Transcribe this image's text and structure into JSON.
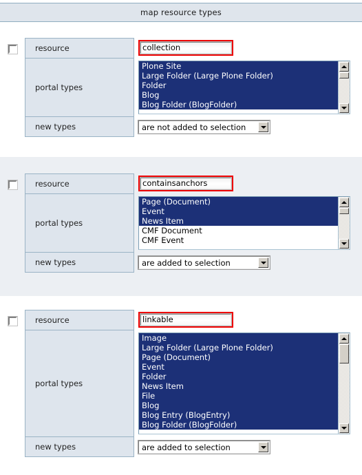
{
  "header": {
    "title": "map resource types"
  },
  "labels": {
    "resource": "resource",
    "portal_types": "portal types",
    "new_types": "new types"
  },
  "sections": [
    {
      "id": "collection",
      "checkbox_checked": false,
      "resource_value": "collection",
      "resource_highlighted": true,
      "portal_types_options": [
        {
          "label": "Plone Site",
          "selected": true
        },
        {
          "label": "Large Folder (Large Plone Folder)",
          "selected": true
        },
        {
          "label": "Folder",
          "selected": true
        },
        {
          "label": "Blog",
          "selected": true
        },
        {
          "label": "Blog Folder (BlogFolder)",
          "selected": true
        }
      ],
      "new_types_value": "are not added to selection",
      "visible_rows": 5
    },
    {
      "id": "containsanchors",
      "checkbox_checked": false,
      "resource_value": "containsanchors",
      "resource_highlighted": true,
      "portal_types_options": [
        {
          "label": "Page (Document)",
          "selected": true
        },
        {
          "label": "Event",
          "selected": true
        },
        {
          "label": "News Item",
          "selected": true
        },
        {
          "label": "CMF Document",
          "selected": false
        },
        {
          "label": "CMF Event",
          "selected": false
        }
      ],
      "new_types_value": "are added to selection",
      "visible_rows": 5
    },
    {
      "id": "linkable",
      "checkbox_checked": false,
      "resource_value": "linkable",
      "resource_highlighted": true,
      "portal_types_options": [
        {
          "label": "Image",
          "selected": true
        },
        {
          "label": "Large Folder (Large Plone Folder)",
          "selected": true
        },
        {
          "label": "Page (Document)",
          "selected": true
        },
        {
          "label": "Event",
          "selected": true
        },
        {
          "label": "Folder",
          "selected": true
        },
        {
          "label": "News Item",
          "selected": true
        },
        {
          "label": "File",
          "selected": true
        },
        {
          "label": "Blog",
          "selected": true
        },
        {
          "label": "Blog Entry (BlogEntry)",
          "selected": true
        },
        {
          "label": "Blog Folder (BlogFolder)",
          "selected": true
        }
      ],
      "new_types_value": "are added to selection",
      "visible_rows": 10
    }
  ],
  "colors": {
    "header_bg": "#dfe5ec",
    "header_border": "#8fadc0",
    "label_cell_bg": "#dee5ed",
    "cell_border": "#9ab3c5",
    "band_bg": "#eceff3",
    "selection_bg": "#1c3077",
    "highlight_border": "#ee0000"
  },
  "icons": {
    "scroll_up": "scroll-up-arrow-icon",
    "scroll_down": "scroll-down-arrow-icon",
    "dropdown": "chevron-down-icon"
  }
}
